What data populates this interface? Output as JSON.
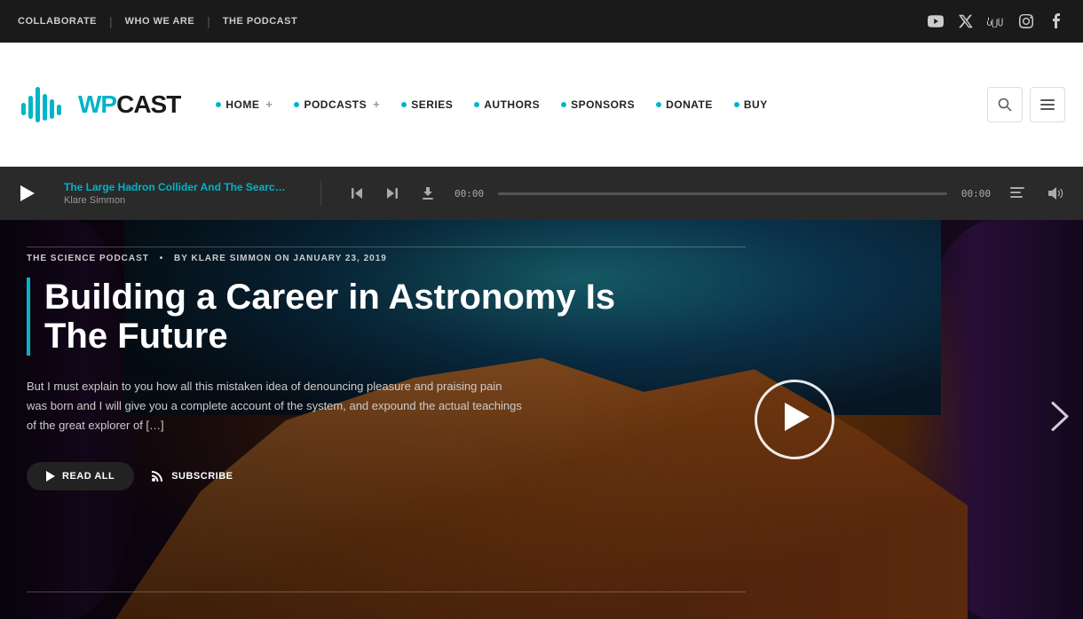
{
  "topbar": {
    "nav": [
      {
        "label": "COLLABORATE",
        "id": "collaborate"
      },
      {
        "label": "WHO WE ARE",
        "id": "who-we-are"
      },
      {
        "label": "THE PODCAST",
        "id": "the-podcast"
      }
    ],
    "social": [
      {
        "name": "youtube-icon",
        "symbol": "▶"
      },
      {
        "name": "twitter-x-icon",
        "symbol": "✕"
      },
      {
        "name": "soundcloud-icon",
        "symbol": "☁"
      },
      {
        "name": "instagram-icon",
        "symbol": "◉"
      },
      {
        "name": "facebook-icon",
        "symbol": "f"
      }
    ]
  },
  "header": {
    "logo_wp": "WP",
    "logo_cast": "CAST",
    "search_label": "Search",
    "menu_label": "Menu",
    "nav": [
      {
        "label": "HOME",
        "has_dot": true,
        "has_plus": true,
        "id": "home"
      },
      {
        "label": "PODCASTS",
        "has_dot": true,
        "has_plus": true,
        "id": "podcasts"
      },
      {
        "label": "SERIES",
        "has_dot": true,
        "has_plus": false,
        "id": "series"
      },
      {
        "label": "AUTHORS",
        "has_dot": true,
        "has_plus": false,
        "id": "authors"
      },
      {
        "label": "SPONSORS",
        "has_dot": true,
        "has_plus": false,
        "id": "sponsors"
      },
      {
        "label": "DONATE",
        "has_dot": true,
        "has_plus": false,
        "id": "donate"
      },
      {
        "label": "BUY",
        "has_dot": true,
        "has_plus": false,
        "id": "buy"
      }
    ]
  },
  "player": {
    "play_label": "▶",
    "track_title": "The Large Hadron Collider And The Searc…",
    "track_author": "Klare Simmon",
    "time_left": "00:00",
    "time_right": "00:00",
    "prev_label": "⏮",
    "next_label": "⏭",
    "download_label": "⬇",
    "queue_label": "≡",
    "volume_label": "🔊"
  },
  "hero": {
    "category": "THE SCIENCE PODCAST",
    "meta": "BY KLARE SIMMON ON JANUARY 23, 2019",
    "title": "Building a Career in Astronomy Is The Future",
    "excerpt": "But I must explain to you how all this mistaken idea of denouncing pleasure and praising pain was born and I will give you a complete account of the system, and expound the actual teachings of the great explorer of […]",
    "read_all_label": "READ ALL",
    "subscribe_label": "SUBSCRIBE",
    "play_label": "▶",
    "next_arrow": "❯"
  }
}
